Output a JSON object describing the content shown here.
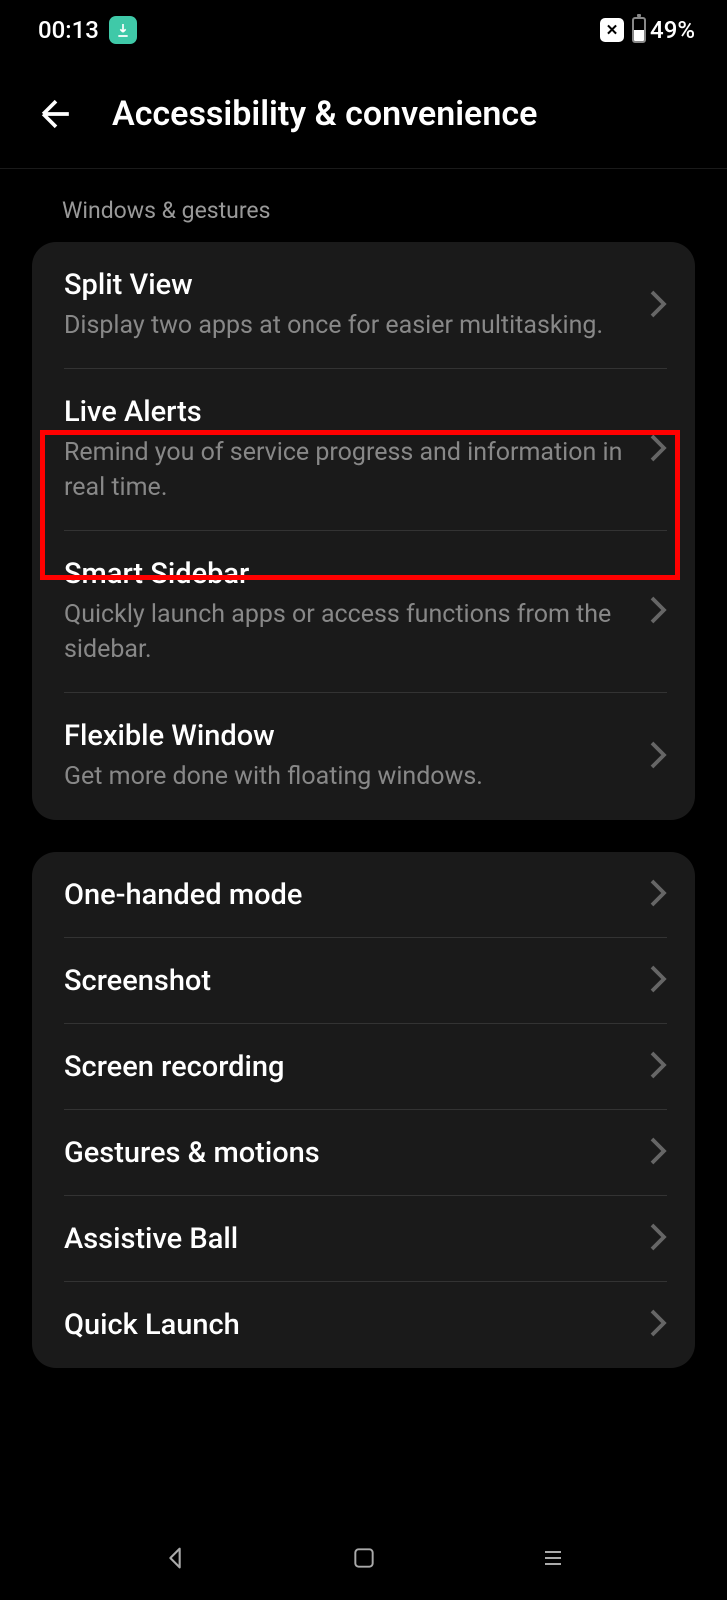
{
  "status": {
    "time": "00:13",
    "battery_percent": "49%"
  },
  "header": {
    "title": "Accessibility & convenience"
  },
  "section1": {
    "label": "Windows & gestures",
    "items": [
      {
        "title": "Split View",
        "description": "Display two apps at once for easier multitasking."
      },
      {
        "title": "Live Alerts",
        "description": "Remind you of service progress and information in real time."
      },
      {
        "title": "Smart Sidebar",
        "description": "Quickly launch apps or access functions from the sidebar."
      },
      {
        "title": "Flexible Window",
        "description": "Get more done with floating windows."
      }
    ]
  },
  "section2": {
    "items": [
      {
        "title": "One-handed mode"
      },
      {
        "title": "Screenshot"
      },
      {
        "title": "Screen recording"
      },
      {
        "title": "Gestures & motions"
      },
      {
        "title": "Assistive Ball"
      },
      {
        "title": "Quick Launch"
      }
    ]
  }
}
